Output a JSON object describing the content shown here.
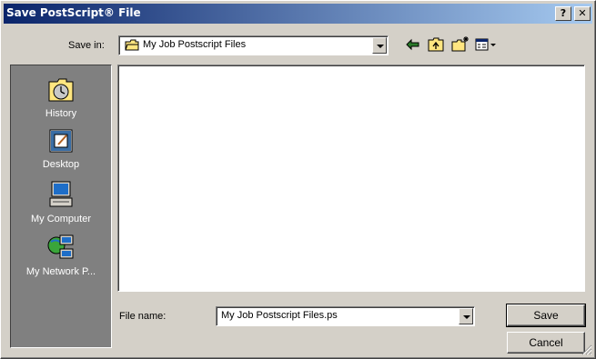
{
  "window": {
    "title": "Save PostScript® File",
    "help_label": "?",
    "close_label": "✕"
  },
  "save_in": {
    "label": "Save in:",
    "value": "My Job Postscript Files"
  },
  "toolbar": {
    "back_icon": "back-arrow-icon",
    "up_icon": "up-folder-icon",
    "new_folder_icon": "new-folder-icon",
    "view_icon": "view-menu-icon"
  },
  "places": [
    {
      "label": "History",
      "icon": "history-icon"
    },
    {
      "label": "Desktop",
      "icon": "desktop-icon"
    },
    {
      "label": "My Computer",
      "icon": "my-computer-icon"
    },
    {
      "label": "My Network P...",
      "icon": "network-places-icon"
    }
  ],
  "file_name": {
    "label": "File name:",
    "value": "My Job Postscript Files.ps"
  },
  "buttons": {
    "save": "Save",
    "cancel": "Cancel"
  },
  "colors": {
    "title_start": "#0a246a",
    "title_end": "#a6caf0",
    "face": "#d4d0c8",
    "places_bg": "#808080"
  }
}
